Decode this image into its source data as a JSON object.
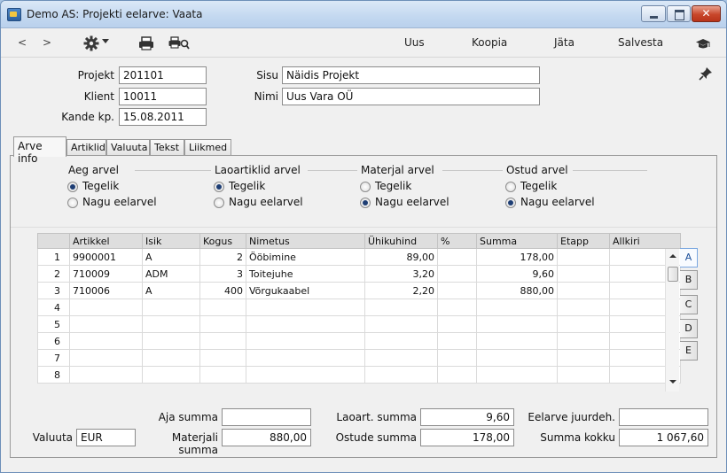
{
  "window": {
    "title": "Demo AS: Projekti eelarve: Vaata",
    "close_glyph": "✕"
  },
  "toolbar": {
    "prev": "<",
    "next": ">",
    "uus": "Uus",
    "koopia": "Koopia",
    "jata": "Jäta",
    "salvesta": "Salvesta"
  },
  "header": {
    "projekt_label": "Projekt",
    "projekt_value": "201101",
    "klient_label": "Klient",
    "klient_value": "10011",
    "kande_label": "Kande kp.",
    "kande_value": "15.08.2011",
    "sisu_label": "Sisu",
    "sisu_value": "Näidis Projekt",
    "nimi_label": "Nimi",
    "nimi_value": "Uus Vara OÜ"
  },
  "tabs": [
    "Arve info",
    "Artiklid",
    "Valuuta",
    "Tekst",
    "Liikmed"
  ],
  "groups": [
    {
      "title": "Aeg arvel",
      "opt1": "Tegelik",
      "opt2": "Nagu eelarvel",
      "selected": 1
    },
    {
      "title": "Laoartiklid arvel",
      "opt1": "Tegelik",
      "opt2": "Nagu eelarvel",
      "selected": 1
    },
    {
      "title": "Materjal arvel",
      "opt1": "Tegelik",
      "opt2": "Nagu eelarvel",
      "selected": 2
    },
    {
      "title": "Ostud arvel",
      "opt1": "Tegelik",
      "opt2": "Nagu eelarvel",
      "selected": 2
    }
  ],
  "grid": {
    "columns": [
      "",
      "Artikkel",
      "Isik",
      "Kogus",
      "Nimetus",
      "Ühikuhind",
      "%",
      "Summa",
      "Etapp",
      "Allkiri"
    ],
    "rows": [
      [
        "1",
        "9900001",
        "A",
        "2",
        "Ööbimine",
        "89,00",
        "",
        "178,00",
        "",
        ""
      ],
      [
        "2",
        "710009",
        "ADM",
        "3",
        "Toitejuhe",
        "3,20",
        "",
        "9,60",
        "",
        ""
      ],
      [
        "3",
        "710006",
        "A",
        "400",
        "Võrgukaabel",
        "2,20",
        "",
        "880,00",
        "",
        ""
      ],
      [
        "4",
        "",
        "",
        "",
        "",
        "",
        "",
        "",
        "",
        ""
      ],
      [
        "5",
        "",
        "",
        "",
        "",
        "",
        "",
        "",
        "",
        ""
      ],
      [
        "6",
        "",
        "",
        "",
        "",
        "",
        "",
        "",
        "",
        ""
      ],
      [
        "7",
        "",
        "",
        "",
        "",
        "",
        "",
        "",
        "",
        ""
      ],
      [
        "8",
        "",
        "",
        "",
        "",
        "",
        "",
        "",
        "",
        ""
      ]
    ],
    "side_tabs": [
      "A",
      "B",
      "C",
      "D",
      "E"
    ]
  },
  "footer": {
    "aja_label": "Aja summa",
    "aja_value": "",
    "valuuta_label": "Valuuta",
    "valuuta_value": "EUR",
    "materjali_label": "Materjali summa",
    "materjali_value": "880,00",
    "laoart_label": "Laoart. summa",
    "laoart_value": "9,60",
    "ostude_label": "Ostude summa",
    "ostude_value": "178,00",
    "eelarve_label": "Eelarve juurdeh.",
    "eelarve_value": "",
    "summa_label": "Summa kokku",
    "summa_value": "1 067,60"
  },
  "colors": {
    "title_bar": "#c3d8f0",
    "active_tab_text": "#1b4f9a",
    "radio_dot": "#1e3e74",
    "close_button": "#c8472b"
  }
}
